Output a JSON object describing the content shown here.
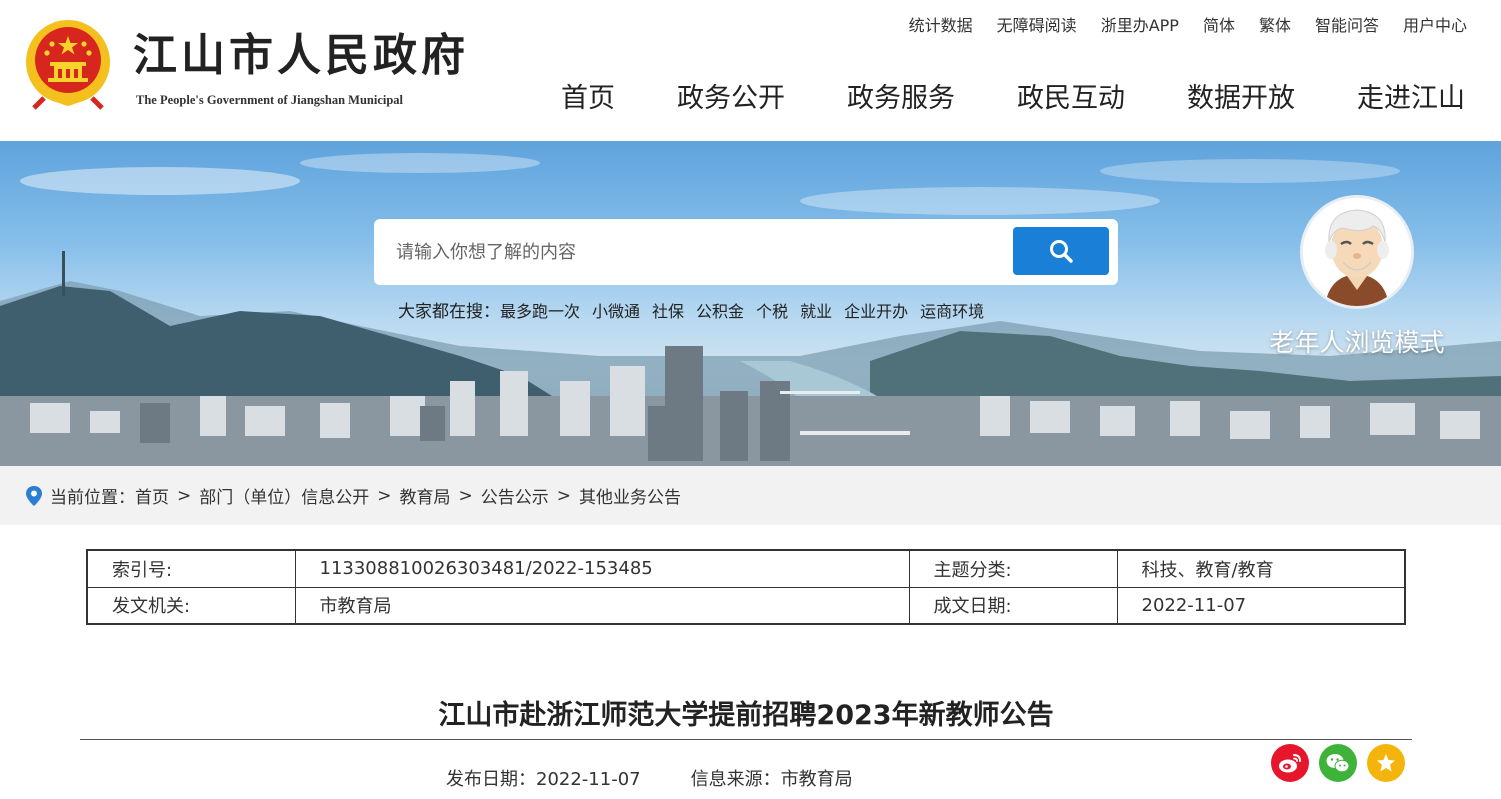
{
  "header": {
    "title": "江山市人民政府",
    "subtitle": "The People's Government of Jiangshan Municipal",
    "top_links": [
      "统计数据",
      "无障碍阅读",
      "浙里办APP",
      "简体",
      "繁体",
      "智能问答",
      "用户中心"
    ],
    "nav": [
      "首页",
      "政务公开",
      "政务服务",
      "政民互动",
      "数据开放",
      "走进江山"
    ]
  },
  "search": {
    "placeholder": "请输入你想了解的内容",
    "hot_label": "大家都在搜：",
    "hot_items": [
      "最多跑一次",
      "小微通",
      "社保",
      "公积金",
      "个税",
      "就业",
      "企业开办",
      "运商环境"
    ]
  },
  "elder_mode": {
    "label": "老年人浏览模式"
  },
  "breadcrumb": {
    "label": "当前位置：",
    "items": [
      "首页",
      "部门（单位）信息公开",
      "教育局",
      "公告公示",
      "其他业务公告"
    ],
    "separator": ">"
  },
  "meta": {
    "index_label": "索引号:",
    "index_value": "113308810026303481/2022-153485",
    "topic_label": "主题分类:",
    "topic_value": "科技、教育/教育",
    "issuer_label": "发文机关:",
    "issuer_value": "市教育局",
    "date_label": "成文日期:",
    "date_value": "2022-11-07"
  },
  "article": {
    "title": "江山市赴浙江师范大学提前招聘2023年新教师公告",
    "publish_date_label": "发布日期：",
    "publish_date": "2022-11-07",
    "source_label": "信息来源：",
    "source": "市教育局"
  },
  "share": [
    "weibo-icon",
    "wechat-icon",
    "favorite-icon"
  ],
  "colors": {
    "search_button": "#1a7fd6",
    "weibo": "#e6162d",
    "wechat": "#3fb23a",
    "favorite": "#f5b40b",
    "location_pin": "#2a7fd4"
  }
}
